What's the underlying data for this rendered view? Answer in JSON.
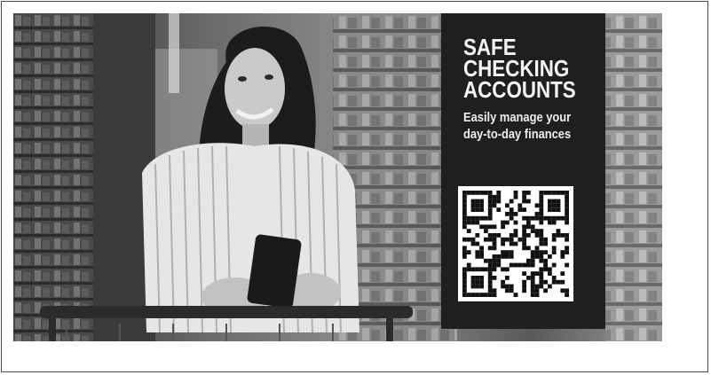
{
  "ad": {
    "headline_lines": [
      "SAFE",
      "CHECKING",
      "ACCOUNTS"
    ],
    "subhead_lines": [
      "Easily manage your",
      "day-to-day finances"
    ]
  },
  "colors": {
    "panel": "#1f1f1f",
    "text": "#f4f4f4",
    "frame": "#4a4a4a"
  }
}
